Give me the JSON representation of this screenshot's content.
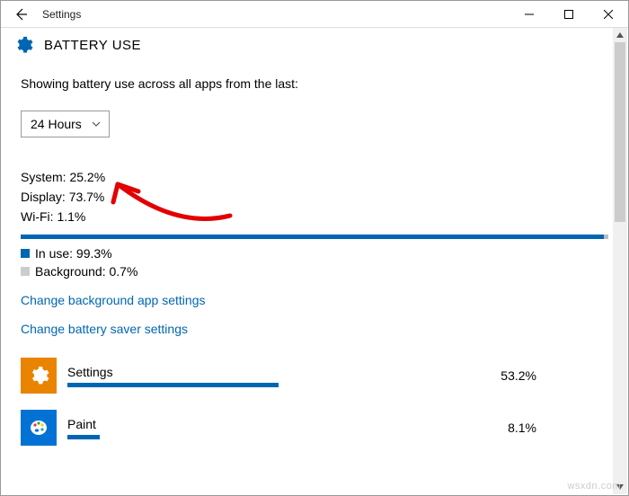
{
  "window": {
    "title": "Settings",
    "page_title": "BATTERY USE"
  },
  "description": "Showing battery use across all apps from the last:",
  "timeframe": {
    "value": "24 Hours"
  },
  "stats": {
    "system_label": "System:",
    "system_value": "25.2%",
    "display_label": "Display:",
    "display_value": "73.7%",
    "wifi_label": "Wi-Fi:",
    "wifi_value": "1.1%"
  },
  "usage_split": {
    "in_use_label": "In use:",
    "in_use_value": "99.3%",
    "in_use_pct": 99.3,
    "background_label": "Background:",
    "background_value": "0.7%",
    "background_pct": 0.7,
    "in_use_color": "#0066b3",
    "background_color": "#bbbbbb"
  },
  "links": {
    "bg_settings": "Change background app settings",
    "saver_settings": "Change battery saver settings"
  },
  "apps": [
    {
      "name": "Settings",
      "pct_text": "53.2%",
      "pct": 53.2,
      "icon_bg": "#e98300"
    },
    {
      "name": "Paint",
      "pct_text": "8.1%",
      "pct": 8.1,
      "icon_bg": "#0372d4"
    }
  ],
  "watermark": "wsxdn.com",
  "colors": {
    "accent": "#0066b3"
  }
}
